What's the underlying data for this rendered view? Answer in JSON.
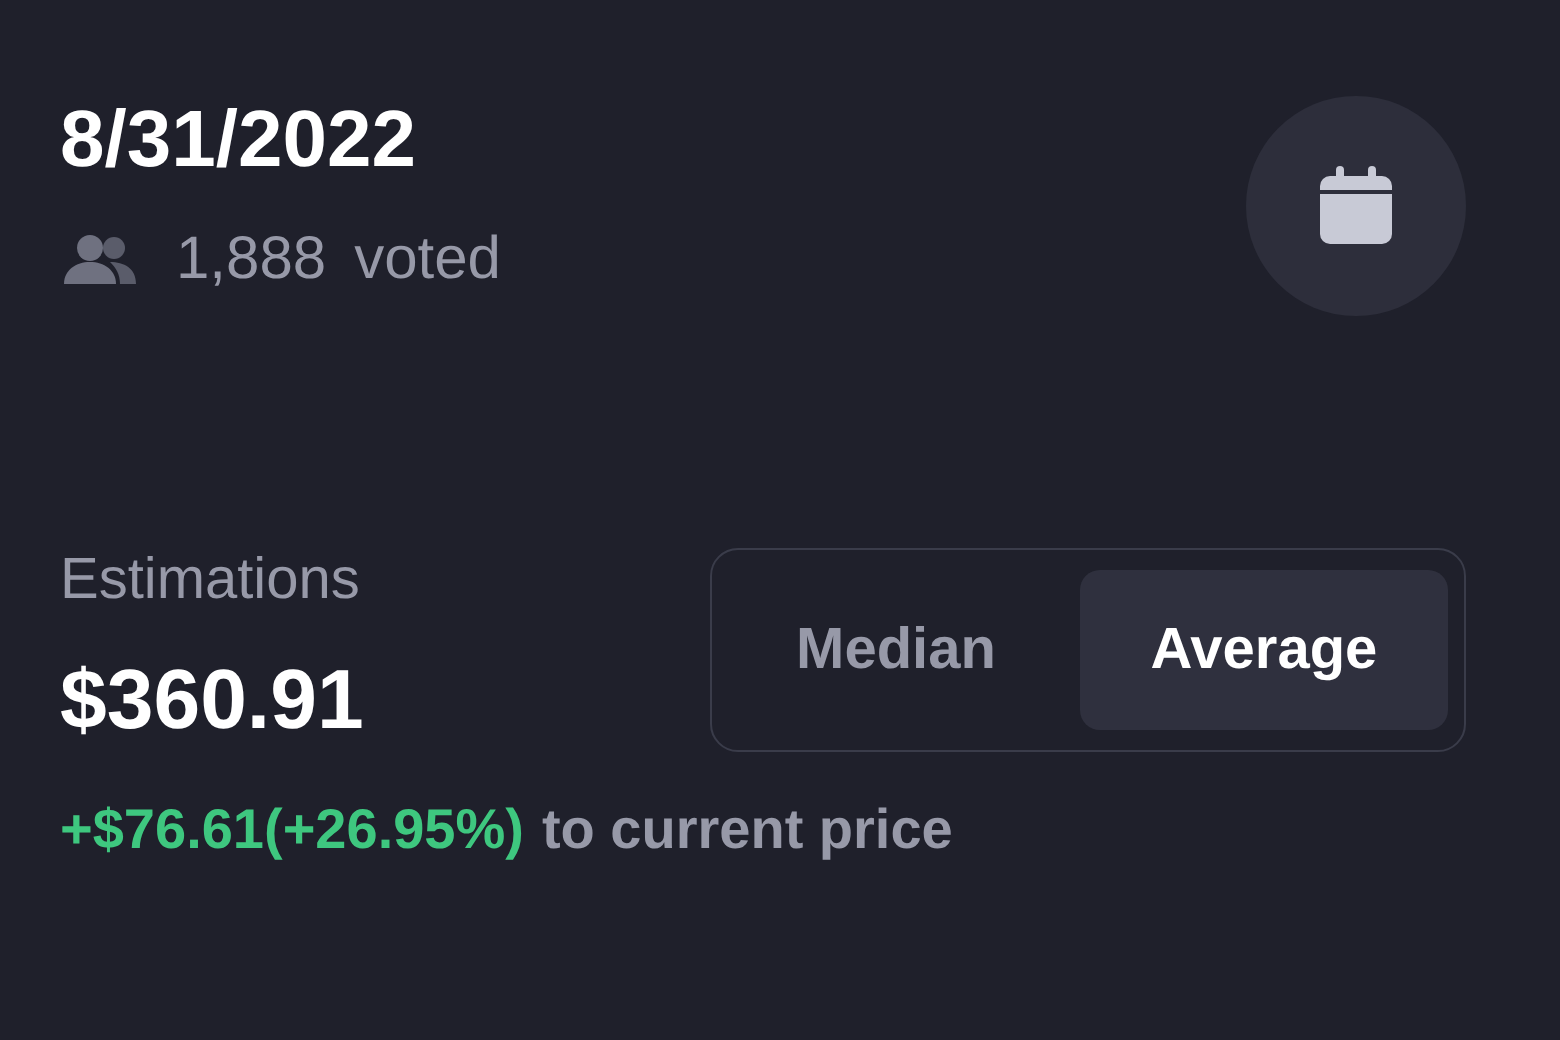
{
  "date": "8/31/2022",
  "voters": {
    "count": "1,888",
    "label": "voted"
  },
  "estimations": {
    "label": "Estimations",
    "value": "$360.91",
    "change": "+$76.61(+26.95%)",
    "change_note": "to current price"
  },
  "toggle": [
    {
      "label": "Median",
      "selected": false
    },
    {
      "label": "Average",
      "selected": true
    }
  ]
}
